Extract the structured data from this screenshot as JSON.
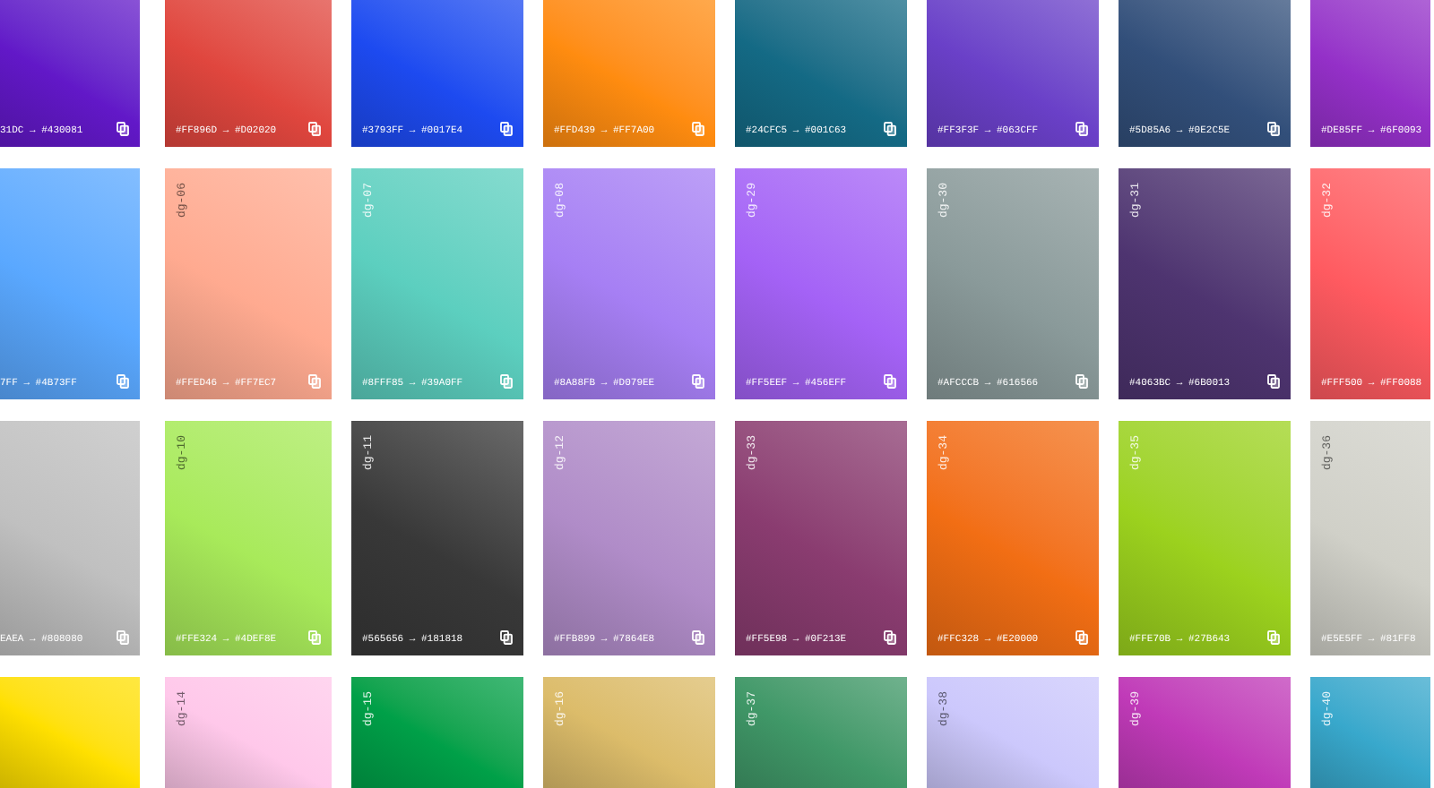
{
  "rows": [
    {
      "cards": [
        {
          "color": "#6218c8",
          "code": "31DC → #430081"
        },
        {
          "color": "#e0463e",
          "code": "#FF896D → #D02020"
        },
        {
          "color": "#1d4af0",
          "code": "#3793FF → #0017E4"
        },
        {
          "color": "#ff8c10",
          "code": "#FFD439 → #FF7A00"
        },
        {
          "color": "#146a85",
          "code": "#24CFC5 → #001C63"
        },
        {
          "color": "#6a40c8",
          "code": "#FF3F3F → #063CFF"
        },
        {
          "color": "#324f7a",
          "code": "#5D85A6 → #0E2C5E"
        },
        {
          "color": "#9430c8",
          "code": "#DE85FF → #6F0093"
        }
      ]
    },
    {
      "cards": [
        {
          "color": "#5aa8ff",
          "code": "7FF → #4B73FF"
        },
        {
          "color": "#ffaa90",
          "label": "dg-06",
          "code": "#FFED46 → #FF7EC7"
        },
        {
          "color": "#5ccfbf",
          "label": "dg-07",
          "code": "#8FFF85 → #39A0FF"
        },
        {
          "color": "#a67ff4",
          "label": "dg-08",
          "code": "#8A88FB → #D079EE"
        },
        {
          "color": "#a462f6",
          "label": "dg-29",
          "code": "#FF5EEF → #456EFF"
        },
        {
          "color": "#8a9a9a",
          "label": "dg-30",
          "code": "#AFCCCB → #616566"
        },
        {
          "color": "#4e3470",
          "label": "dg-31",
          "code": "#4063BC → #6B0013"
        },
        {
          "color": "#ff5a60",
          "label": "dg-32",
          "code": "#FFF500 → #FF0088"
        }
      ]
    },
    {
      "cards": [
        {
          "color": "#c0c0c0",
          "code": "EAEA → #808080"
        },
        {
          "color": "#a8ea5a",
          "label": "dg-10",
          "code": "#FFE324 → #4DEF8E"
        },
        {
          "color": "#383838",
          "label": "dg-11",
          "code": "#565656 → #181818"
        },
        {
          "color": "#b08cc8",
          "label": "dg-12",
          "code": "#FFB899 → #7864E8"
        },
        {
          "color": "#8a3c70",
          "label": "dg-33",
          "code": "#FF5E98 → #0F213E"
        },
        {
          "color": "#f26e14",
          "label": "dg-34",
          "code": "#FFC328 → #E20000"
        },
        {
          "color": "#9cd21e",
          "label": "dg-35",
          "code": "#FFE70B → #27B643"
        },
        {
          "color": "#d0d0c8",
          "label": "dg-36",
          "code": "#E5E5FF → #81FF8"
        }
      ]
    },
    {
      "cards": [
        {
          "color": "#ffe000"
        },
        {
          "color": "#ffc8ea",
          "label": "dg-14"
        },
        {
          "color": "#00a048",
          "label": "dg-15"
        },
        {
          "color": "#dcbc6a",
          "label": "dg-16"
        },
        {
          "color": "#409868",
          "label": "dg-37"
        },
        {
          "color": "#ccc8fc",
          "label": "dg-38"
        },
        {
          "color": "#c03ab8",
          "label": "dg-39"
        },
        {
          "color": "#38a8cc",
          "label": "dg-40"
        }
      ]
    }
  ]
}
